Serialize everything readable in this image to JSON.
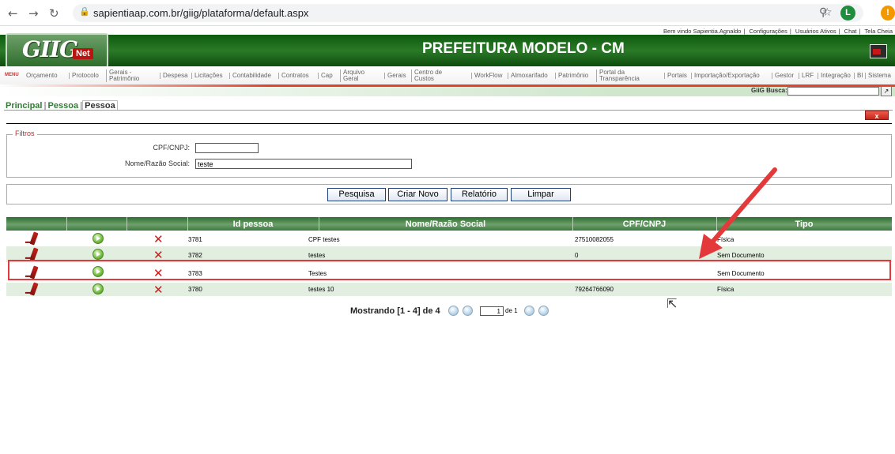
{
  "browser": {
    "url": "sapientiaap.com.br/giig/plataforma/default.aspx",
    "profile_initial": "L",
    "extension_initial": "!"
  },
  "top_links": [
    "Bem vindo Sapientia.Agnaldo",
    "Configurações",
    "Usuários Ativos",
    "Chat",
    "Tela Cheia"
  ],
  "logo": {
    "text": "GIIG",
    "suffix": "Net"
  },
  "header": {
    "title": "PREFEITURA MODELO - CM"
  },
  "menu": {
    "label": "MENU",
    "items": [
      "Orçamento",
      "Protocolo",
      "Gerais - Patrimônio",
      "Despesa",
      "Licitações",
      "Contabilidade",
      "Contratos",
      "Cap",
      "Arquivo Geral",
      "Gerais",
      "Centro de Custos",
      "WorkFlow",
      "Almoxarifado",
      "Patrimônio",
      "Portal da Transparência",
      "Portais",
      "Importação/Exportação",
      "Gestor",
      "LRF",
      "Integração",
      "BI",
      "Sistema"
    ]
  },
  "search": {
    "label": "GiiG Busca:",
    "value": ""
  },
  "breadcrumb": {
    "items": [
      "Principal",
      "Pessoa"
    ],
    "current": "Pessoa"
  },
  "close_label": "x",
  "filters": {
    "legend": "Filtros",
    "cpf_label": "CPF/CNPJ:",
    "cpf_value": "",
    "nome_label": "Nome/Razão Social:",
    "nome_value": "teste"
  },
  "buttons": {
    "pesquisa": "Pesquisa",
    "criar_novo": "Criar Novo",
    "relatorio": "Relatório",
    "limpar": "Limpar"
  },
  "table": {
    "columns": [
      "",
      "",
      "",
      "Id pessoa",
      "Nome/Razão Social",
      "CPF/CNPJ",
      "Tipo"
    ],
    "rows": [
      {
        "id": "3781",
        "nome": "CPF testes",
        "cpf": "27510082055",
        "tipo": "Física"
      },
      {
        "id": "3782",
        "nome": "testes",
        "cpf": "0",
        "tipo": "Sem Documento"
      },
      {
        "id": "3783",
        "nome": "Testes",
        "cpf": "",
        "tipo": "Sem Documento"
      },
      {
        "id": "3780",
        "nome": "testes 10",
        "cpf": "79264766090",
        "tipo": "Física"
      }
    ],
    "highlighted_row": 2
  },
  "pager": {
    "text": "Mostrando [1 - 4] de 4",
    "page": "1",
    "of": "de 1"
  },
  "colors": {
    "header_green": "#2b7a28",
    "highlight_red": "#e4393a",
    "accent_red": "#e0452c"
  }
}
